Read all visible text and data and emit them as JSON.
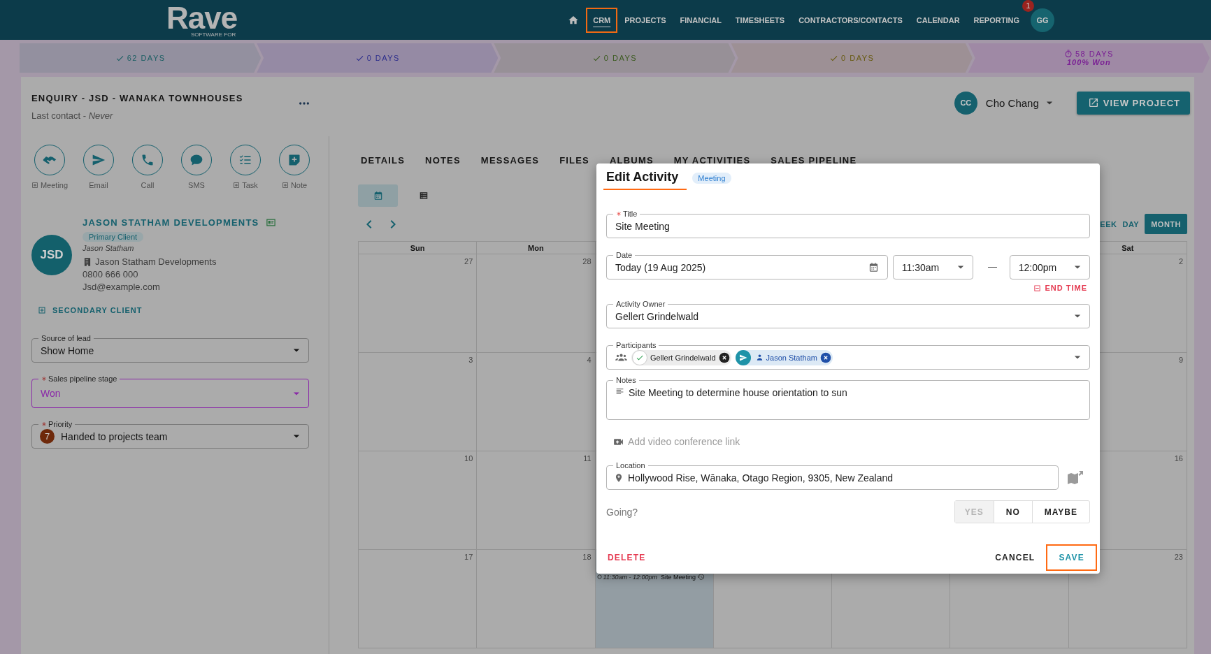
{
  "nav": {
    "logo": "Rave",
    "logo_tagline": "SOFTWARE FOR",
    "items": [
      {
        "label": "CRM",
        "selected": true,
        "highlighted": true
      },
      {
        "label": "PROJECTS",
        "selected": false,
        "highlighted": false
      },
      {
        "label": "FINANCIAL",
        "selected": false,
        "highlighted": false
      },
      {
        "label": "TIMESHEETS",
        "selected": false,
        "highlighted": false
      },
      {
        "label": "CONTRACTORS/CONTACTS",
        "selected": false,
        "highlighted": false
      },
      {
        "label": "CALENDAR",
        "selected": false,
        "highlighted": false
      },
      {
        "label": "REPORTING",
        "selected": false,
        "highlighted": false
      }
    ],
    "avatar": "GG",
    "notification_count": "1"
  },
  "stages": [
    {
      "label": "62 DAYS",
      "kind": "done",
      "color": "#1b5e63"
    },
    {
      "label": "0 DAYS",
      "kind": "done",
      "color": "#2c2d8c"
    },
    {
      "label": "0 DAYS",
      "kind": "done",
      "color": "#3b5a1f"
    },
    {
      "label": "0 DAYS",
      "kind": "done",
      "color": "#675a10"
    },
    {
      "label": "58 DAYS",
      "kind": "current",
      "color": "#7a1f94",
      "note": "100% Won"
    }
  ],
  "record": {
    "title": "ENQUIRY - JSD - WANAKA TOWNHOUSES",
    "last_contact": "Last contact - *Never*"
  },
  "owner": {
    "initials": "CC",
    "name": "Cho Chang"
  },
  "view_project": "VIEW PROJECT",
  "actions": [
    {
      "kind": "meeting",
      "label": "Meeting",
      "addable": true
    },
    {
      "kind": "email",
      "label": "Email",
      "addable": false
    },
    {
      "kind": "call",
      "label": "Call",
      "addable": false
    },
    {
      "kind": "sms",
      "label": "SMS",
      "addable": false
    },
    {
      "kind": "task",
      "label": "Task",
      "addable": true
    },
    {
      "kind": "note",
      "label": "Note",
      "addable": true
    }
  ],
  "client": {
    "name": "JASON STATHAM DEVELOPMENTS",
    "tag": "Primary Client",
    "initials": "JSD",
    "contact": "Jason Statham",
    "company": "Jason Statham Developments",
    "phone": "0800 666 000",
    "email": "Jsd@example.com"
  },
  "secondary_client": "SECONDARY CLIENT",
  "fields": [
    {
      "label": "Source of lead",
      "required": false,
      "value": "Show Home",
      "color": "#151515"
    },
    {
      "label": "Sales pipeline stage",
      "required": true,
      "value": "Won",
      "color": "#8a2aa8"
    },
    {
      "label": "Priority",
      "required": true,
      "value": "Handed to projects team",
      "badge": "7",
      "color": "#151515"
    }
  ],
  "tabs": [
    {
      "label": "DETAILS",
      "selected": false
    },
    {
      "label": "NOTES",
      "selected": false
    },
    {
      "label": "MESSAGES",
      "selected": false
    },
    {
      "label": "FILES",
      "selected": false
    },
    {
      "label": "ALBUMS",
      "selected": false
    },
    {
      "label": "MY ACTIVITIES",
      "selected": false
    },
    {
      "label": "SALES PIPELINE",
      "selected": false
    }
  ],
  "view_toggle": [
    {
      "kind": "calendar",
      "selected": true
    },
    {
      "kind": "list",
      "selected": false
    }
  ],
  "range_buttons": [
    {
      "label": "EEK",
      "selected": false
    },
    {
      "label": "DAY",
      "selected": false
    },
    {
      "label": "MONTH",
      "selected": true
    }
  ],
  "calendar": {
    "weekdays": {
      "sun": "Sun",
      "mon": "Mon",
      "sat": "Sat"
    },
    "weeks": [
      {
        "sun": {
          "day": "27",
          "today": false
        },
        "mon": {
          "day": "28",
          "today": false
        },
        "sat": {
          "day": "2",
          "today": false
        }
      },
      {
        "sun": {
          "day": "3",
          "today": false
        },
        "mon": {
          "day": "4",
          "today": false
        },
        "sat": {
          "day": "9",
          "today": false
        }
      },
      {
        "sun": {
          "day": "10",
          "today": false
        },
        "mon": {
          "day": "11",
          "today": false
        },
        "sat": {
          "day": "16",
          "today": false
        }
      },
      {
        "sun": {
          "day": "17",
          "today": false
        },
        "mon": {
          "day": "18",
          "today": false
        },
        "tue": {
          "today": true,
          "events": [
            {
              "time": "11:30am - 12:00pm",
              "title": "Site Meeting"
            }
          ]
        },
        "wed": {
          "today": false
        },
        "thu": {
          "today": false
        },
        "fri": {
          "today": false
        },
        "sat": {
          "day": "23",
          "today": false
        }
      }
    ]
  },
  "dialog": {
    "title": "Edit Activity",
    "badge": "Meeting",
    "title_field": {
      "label": "Title",
      "required": true,
      "value": "Site Meeting"
    },
    "date": {
      "label": "Date",
      "value": "Today (19 Aug 2025)"
    },
    "start_time": "11:30am",
    "end_time": "12:00pm",
    "end_time_toggle": "END TIME",
    "owner": {
      "label": "Activity Owner",
      "value": "Gellert Grindelwald"
    },
    "participants": {
      "label": "Participants",
      "items": [
        {
          "name": "Gellert Grindelwald",
          "kind": "accepted"
        },
        {
          "name": "Jason Statham",
          "kind": "invited"
        }
      ]
    },
    "notes": {
      "label": "Notes",
      "value": "Site Meeting to determine house orientation to sun"
    },
    "video_link": "Add video conference link",
    "location": {
      "label": "Location",
      "value": "Hollywood Rise, Wānaka, Otago Region, 9305, New Zealand"
    },
    "going": {
      "label": "Going?",
      "options": [
        {
          "label": "YES",
          "disabled": true
        },
        {
          "label": "NO",
          "disabled": false
        },
        {
          "label": "MAYBE",
          "disabled": false
        }
      ]
    },
    "delete": "DELETE",
    "cancel": "CANCEL",
    "save": {
      "label": "SAVE",
      "highlighted": true
    }
  }
}
